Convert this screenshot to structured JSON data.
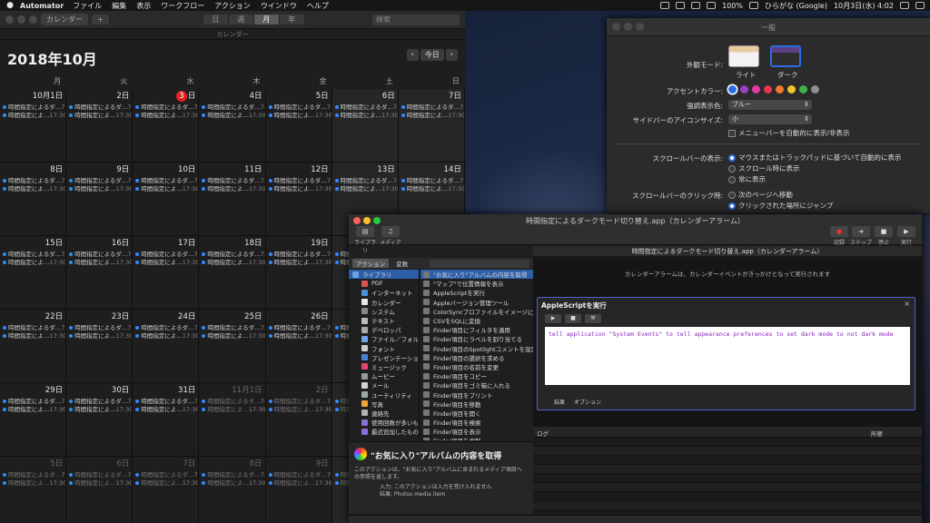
{
  "menubar": {
    "app": "Automator",
    "items": [
      "ファイル",
      "編集",
      "表示",
      "ワークフロー",
      "アクション",
      "ウインドウ",
      "ヘルプ"
    ],
    "battery": "100%",
    "input_method": "ひらがな (Google)",
    "clock": "10月3日(水) 4:02"
  },
  "calendar": {
    "toolbar": {
      "calendars_btn": "カレンダー",
      "add_btn": "+",
      "views": [
        "日",
        "週",
        "月",
        "年"
      ],
      "search_placeholder": "検索"
    },
    "subtitle": "カレンダー",
    "title": "2018年10月",
    "today_btn": "今日",
    "prev": "‹",
    "next": "›",
    "weekdays": [
      "月",
      "火",
      "水",
      "木",
      "金",
      "土",
      "日"
    ],
    "days": [
      "10月1日",
      "2日",
      "3日",
      "4日",
      "5日",
      "6日",
      "7日",
      "8日",
      "9日",
      "10日",
      "11日",
      "12日",
      "13日",
      "14日",
      "15日",
      "16日",
      "17日",
      "18日",
      "19日",
      "20日",
      "21日",
      "22日",
      "23日",
      "24日",
      "25日",
      "26日",
      "27日",
      "28日",
      "29日",
      "30日",
      "31日",
      "11月1日",
      "2日",
      "3日",
      "4日",
      "5日",
      "6日",
      "7日",
      "8日",
      "9日",
      "10日",
      "11日"
    ],
    "today_number": "3",
    "today_suffix": "日",
    "events": [
      {
        "name": "時間指定によるダ…",
        "time": "7:30"
      },
      {
        "name": "時間指定によ…",
        "time": "17:30"
      }
    ]
  },
  "prefs": {
    "title": "一般",
    "appearance_label": "外観モード:",
    "light": "ライト",
    "dark": "ダーク",
    "accent_label": "アクセントカラー:",
    "accent_colors": [
      "#2d6de3",
      "#9b3fc4",
      "#e23aa2",
      "#e8384f",
      "#f2792a",
      "#f5c32c",
      "#3db34a",
      "#8e8e93"
    ],
    "highlight_label": "強調表示色:",
    "highlight_value": "ブルー",
    "sidebar_label": "サイドバーのアイコンサイズ:",
    "sidebar_value": "小",
    "menubar_option": "メニューバーを自動的に表示/非表示",
    "scroll_label": "スクロールバーの表示:",
    "scroll_options": [
      "マウスまたはトラックパッドに基づいて自動的に表示",
      "スクロール時に表示",
      "常に表示"
    ],
    "click_label": "スクロールバーのクリック時:",
    "click_options": [
      "次のページへ移動",
      "クリックされた場所にジャンプ"
    ]
  },
  "automator": {
    "title": "時間指定によるダークモード切り替え.app（カレンダーアラーム）",
    "subtitle": "時間指定によるダークモード切り替え.app（カレンダーアラーム）",
    "tool_library": "ライブラリ",
    "tool_media": "メディア",
    "tool_record": "記録",
    "tool_step": "ステップ実行",
    "tool_stop": "停止",
    "tool_run": "実行",
    "tab_actions": "アクション",
    "tab_variables": "変数",
    "library": [
      "ライブラリ",
      "PDF",
      "インターネット",
      "カレンダー",
      "システム",
      "テキスト",
      "デベロッパ",
      "ファイル／フォルダ",
      "フォント",
      "プレゼンテーション",
      "ミュージック",
      "ムービー",
      "メール",
      "ユーティリティ",
      "写真",
      "連絡先",
      "使用回数が多いもの",
      "最近追加したもの"
    ],
    "actions": [
      "\"お気に入り\"アルバムの内容を取得",
      "\"マップ\"で位置情報を表示",
      "AppleScriptを実行",
      "Appleバージョン管理ツール",
      "ColorSyncプロファイルをイメージに適用",
      "CSVをSQLに変換",
      "Finder項目にフィルタを適用",
      "Finder項目にラベルを割り当てる",
      "Finder項目のSpotlightコメントを設定",
      "Finder項目の選択を求める",
      "Finder項目の名前を変更",
      "Finder項目をコピー",
      "Finder項目をゴミ箱に入れる",
      "Finder項目をプリント",
      "Finder項目を移動",
      "Finder項目を開く",
      "Finder項目を検索",
      "Finder項目を表示",
      "Finder項目を複製"
    ],
    "desc_title": "\"お気に入り\"アルバムの内容を取得",
    "desc_text": "このアクションは、\"お気に入り\"アルバムに含まれるメディア項目への参照を返します。",
    "desc_input": "入力: このアクションは入力を受け入れません",
    "desc_result": "結果: Photos media item",
    "hint": "カレンダーアラームは、カレンダーイベントがきっかけとなって実行されます",
    "action_title": "AppleScriptを実行",
    "close": "×",
    "code": "tell application \"System Events\" to tell appearance preferences to set dark mode to not dark mode",
    "footer_result": "結果",
    "footer_options": "オプション",
    "log_header": "ログ",
    "duration_header": "所要"
  }
}
